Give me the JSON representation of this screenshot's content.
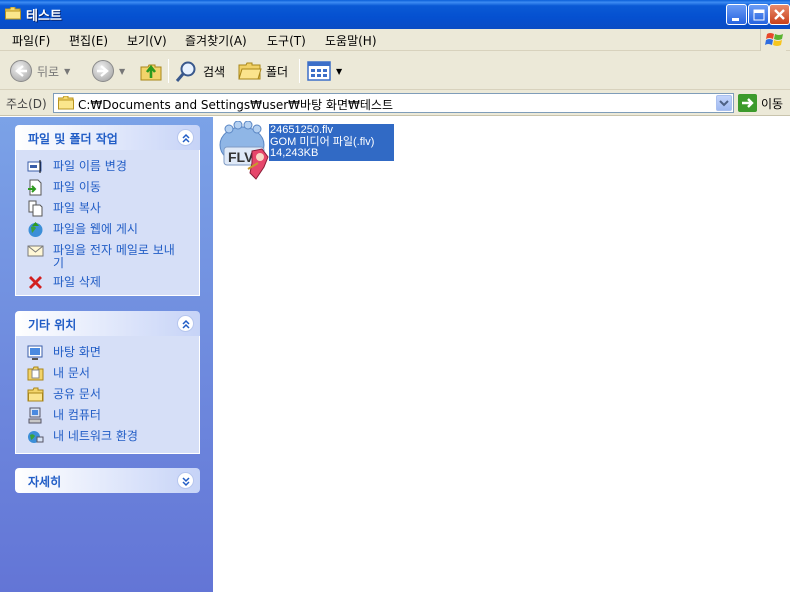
{
  "window": {
    "title": "테스트",
    "buttons": {
      "minimize": "minimize",
      "maximize": "maximize",
      "close": "close"
    }
  },
  "menu": [
    "파일(F)",
    "편집(E)",
    "보기(V)",
    "즐겨찾기(A)",
    "도구(T)",
    "도움말(H)"
  ],
  "toolbar": {
    "back_label": "뒤로",
    "search_label": "검색",
    "folders_label": "폴더"
  },
  "address": {
    "label": "주소(D)",
    "path": "C:₩Documents and Settings₩user₩바탕 화면₩테스트",
    "go_label": "이동"
  },
  "tasks": {
    "file_folder": {
      "title": "파일 및 폴더 작업",
      "items": [
        "파일 이름 변경",
        "파일 이동",
        "파일 복사",
        "파일을 웹에 게시",
        "파일을 전자 메일로 보내기",
        "파일 삭제"
      ]
    },
    "other_places": {
      "title": "기타 위치",
      "items": [
        "바탕 화면",
        "내 문서",
        "공유 문서",
        "내 컴퓨터",
        "내 네트워크 환경"
      ]
    },
    "details": {
      "title": "자세히"
    }
  },
  "file": {
    "name": "24651250.flv",
    "type": "GOM 미디어 파일(.flv)",
    "size": "14,243KB",
    "icon_text": "FLV"
  },
  "colors": {
    "titlebar": "#0a5ad5",
    "selection": "#316ac5",
    "task_link": "#215dc6"
  }
}
